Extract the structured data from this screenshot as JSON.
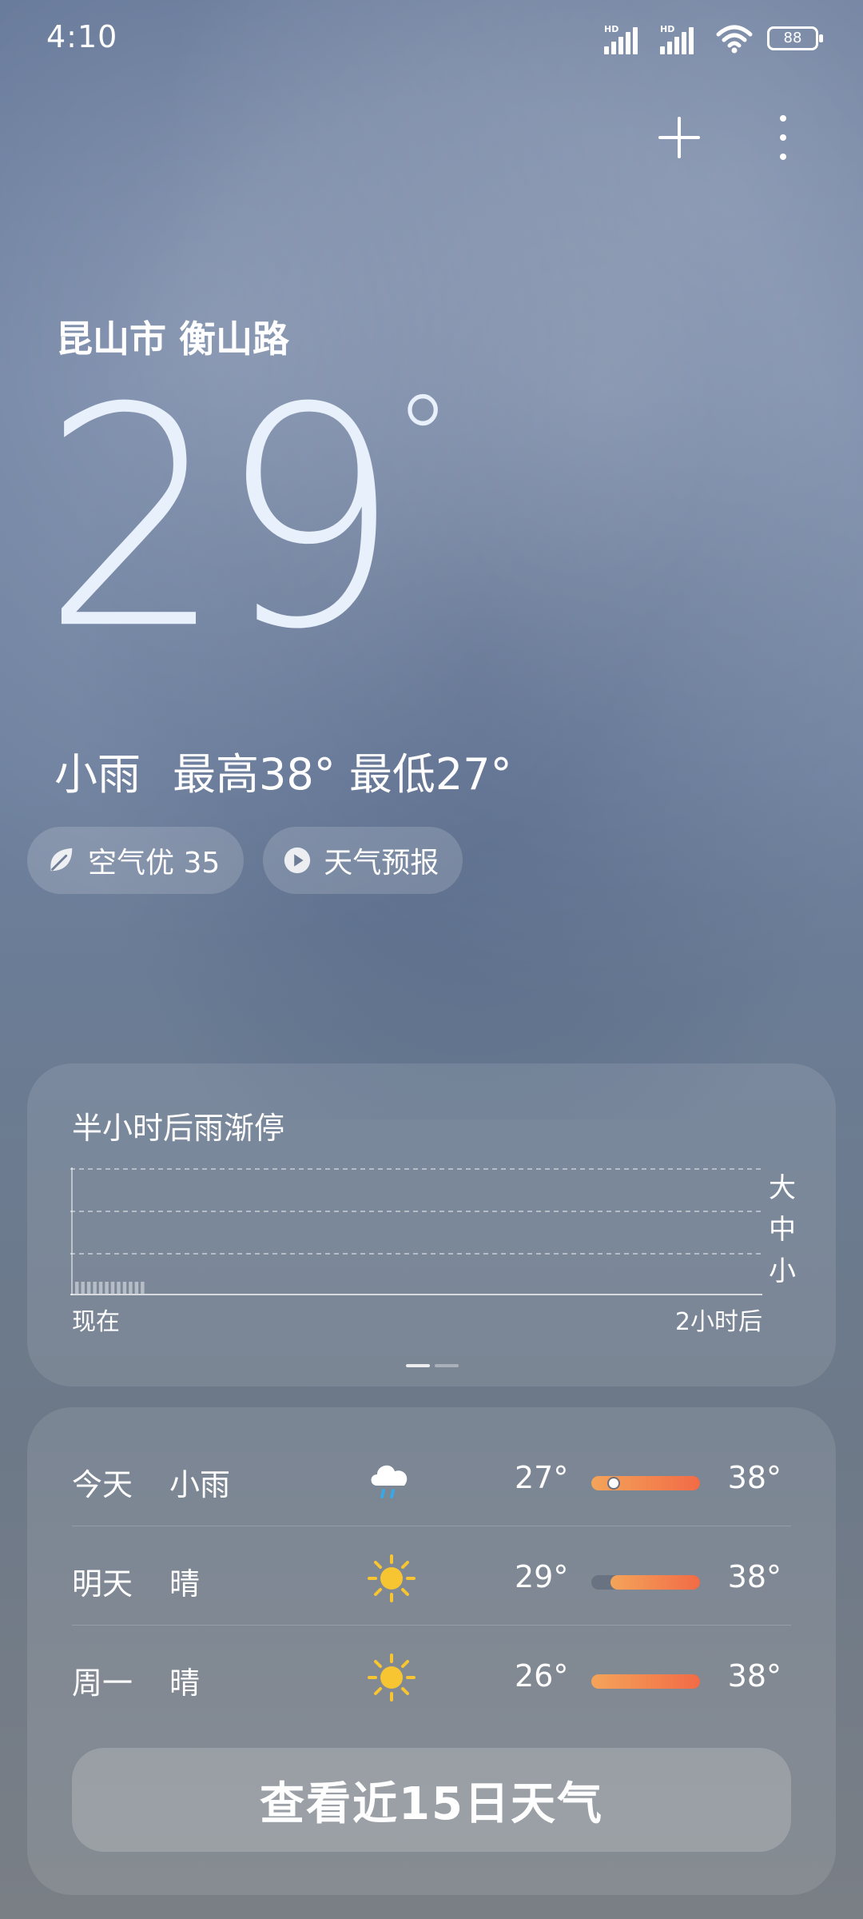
{
  "status_bar": {
    "time": "4:10",
    "network1": "HD",
    "network2": "HD",
    "battery": "88"
  },
  "location": "昆山市 衡山路",
  "current": {
    "temperature": "29",
    "degree_symbol": "°",
    "condition": "小雨",
    "high": "最高38°",
    "low": "最低27°"
  },
  "chips": {
    "air_quality": "空气优 35",
    "forecast_video": "天气预报"
  },
  "rain_card": {
    "title": "半小时后雨渐停",
    "levels": [
      "大",
      "中",
      "小"
    ],
    "x_start": "现在",
    "x_end": "2小时后",
    "intensity_levels": [
      0.1,
      0.1,
      0.1,
      0.1,
      0.1,
      0.1,
      0.1,
      0.1,
      0.1,
      0.1,
      0.1,
      0.1,
      0,
      0,
      0,
      0,
      0,
      0,
      0,
      0,
      0,
      0,
      0,
      0,
      0,
      0,
      0,
      0,
      0,
      0,
      0,
      0,
      0,
      0,
      0,
      0,
      0,
      0,
      0,
      0,
      0,
      0,
      0,
      0,
      0,
      0,
      0,
      0,
      0,
      0,
      0,
      0,
      0,
      0,
      0,
      0,
      0,
      0,
      0,
      0,
      0,
      0,
      0,
      0,
      0,
      0,
      0,
      0,
      0,
      0,
      0,
      0,
      0,
      0,
      0,
      0,
      0,
      0,
      0,
      0,
      0,
      0,
      0,
      0,
      0,
      0,
      0,
      0,
      0,
      0,
      0,
      0,
      0,
      0,
      0,
      0,
      0,
      0,
      0,
      0,
      0,
      0,
      0,
      0,
      0,
      0,
      0,
      0,
      0,
      0,
      0,
      0,
      0,
      0,
      0,
      0
    ]
  },
  "forecast": [
    {
      "day": "今天",
      "condition": "小雨",
      "icon": "rain-cloud-icon",
      "low": "27°",
      "high": "38°",
      "bar_start": 0.0,
      "bar_end": 1.0,
      "current_marker": 0.2
    },
    {
      "day": "明天",
      "condition": "晴",
      "icon": "sun-icon",
      "low": "29°",
      "high": "38°",
      "bar_start": 0.18,
      "bar_end": 1.0
    },
    {
      "day": "周一",
      "condition": "晴",
      "icon": "sun-icon",
      "low": "26°",
      "high": "38°",
      "bar_start": 0.0,
      "bar_end": 1.0
    }
  ],
  "view_15_days": "查看近15日天气",
  "colors": {
    "bar_start": "#f4a45a",
    "bar_end": "#f26b46",
    "sun": "#f7c531"
  }
}
